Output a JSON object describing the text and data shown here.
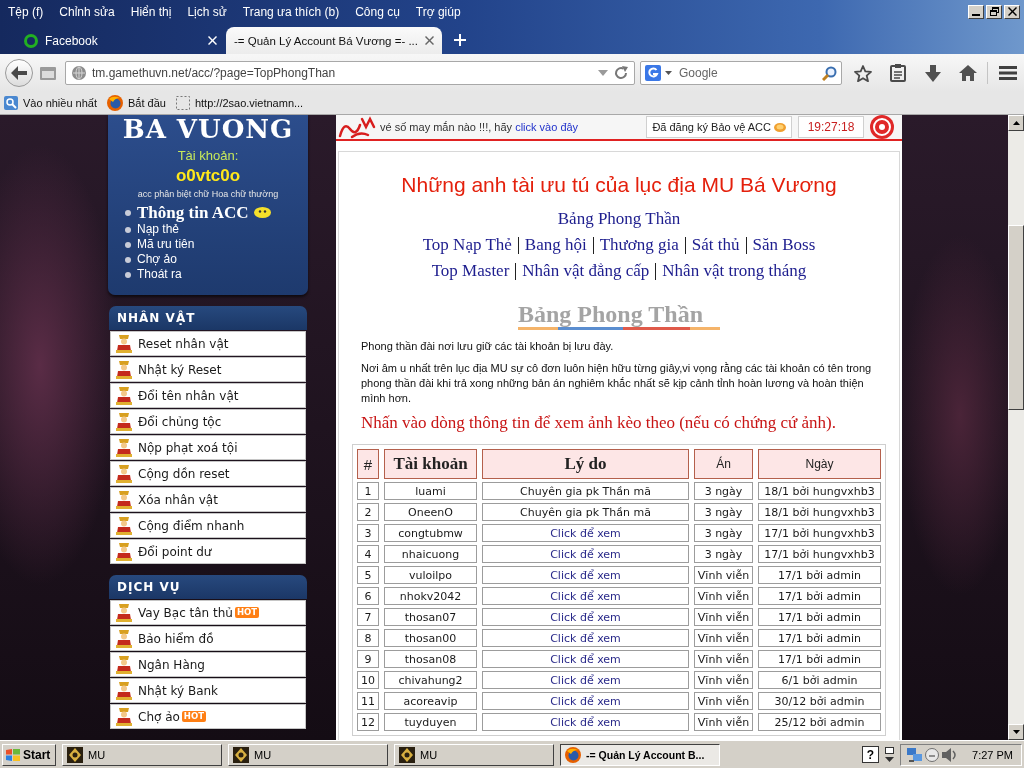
{
  "menu_bar": {
    "items": [
      "Tệp (f)",
      "Chỉnh sửa",
      "Hiển thị",
      "Lịch sử",
      "Trang ưa thích (b)",
      "Công cụ",
      "Trợ giúp"
    ]
  },
  "tabs": [
    {
      "label": "Facebook",
      "selected": false,
      "loading": true
    },
    {
      "label": "-= Quản Lý Account Bá Vương =- ...",
      "selected": true,
      "loading": false
    }
  ],
  "address_bar": {
    "value": "tm.gamethuvn.net/acc/?page=TopPhongThan"
  },
  "search": {
    "placeholder": "Google"
  },
  "bookmarks": [
    {
      "label": "Vào nhiều nhất",
      "kind": "folder"
    },
    {
      "label": "Bắt đầu",
      "kind": "browser"
    },
    {
      "label": "http://2sao.vietnamn...",
      "kind": "page"
    }
  ],
  "account_panel": {
    "logo": "BA VUONG",
    "label": "Tài khoản:",
    "username": "o0vtc0o",
    "note": "acc phân biệt chữ Hoa chữ thường",
    "links": [
      {
        "label": "Thông tin ACC",
        "kind": "heading"
      },
      {
        "label": "Nạp thẻ",
        "kind": "link"
      },
      {
        "label": "Mã ưu tiên",
        "kind": "link"
      },
      {
        "label": "Chợ ảo",
        "kind": "link"
      },
      {
        "label": "Thoát ra",
        "kind": "link"
      }
    ]
  },
  "sidebar": {
    "sections": [
      {
        "title": "NHÂN VẬT",
        "items": [
          {
            "label": "Reset nhân vật"
          },
          {
            "label": "Nhật ký Reset"
          },
          {
            "label": "Đổi tên nhân vật"
          },
          {
            "label": "Đổi chủng tộc"
          },
          {
            "label": "Nộp phạt xoá tội"
          },
          {
            "label": "Cộng dồn reset"
          },
          {
            "label": "Xóa nhân vật"
          },
          {
            "label": "Cộng điểm nhanh"
          },
          {
            "label": "Đổi point dư"
          }
        ]
      },
      {
        "title": "DỊCH VỤ",
        "items": [
          {
            "label": "Vay Bạc tân thủ",
            "badge": "HOT"
          },
          {
            "label": "Bảo hiểm đồ"
          },
          {
            "label": "Ngân Hàng"
          },
          {
            "label": "Nhật ký Bank"
          },
          {
            "label": "Chợ ảo",
            "badge": "HOT"
          }
        ]
      }
    ]
  },
  "banner": {
    "text": "vé số may mắn nào !!!, hãy",
    "link": "click vào đây",
    "protection": "Đã đăng ký Bảo vệ ACC",
    "clock": "19:27:18"
  },
  "content": {
    "title": "Những anh tài ưu tú của lục địa MU Bá Vương",
    "nav_rows": [
      [
        "Bảng Phong Thần"
      ],
      [
        "Top Nạp Thẻ",
        "Bang hội",
        "Thương gia",
        "Sát thủ",
        "Săn Boss"
      ],
      [
        "Top Master",
        "Nhân vật đẳng cấp",
        "Nhân vật trong tháng"
      ]
    ],
    "heading": "Bảng Phong Thần",
    "paragraphs": [
      "Phong thần đài nơi lưu giữ các tài khoản bị lưu đày.",
      "Nơi âm u nhất trên lục địa MU sự cô đơn luôn hiện hữu từng giây,vi vọng rằng các tài khoản có tên trong phong thần đài khi trả xong những bản án nghiêm khắc nhất sẽ kịp cảnh tỉnh hoàn lương và hoàn thiện mình hơn."
    ],
    "instruction": "Nhấn vào dòng thông tin để xem ảnh kèo theo (nếu có chứng cứ ảnh)."
  },
  "table": {
    "columns": [
      {
        "label": "#",
        "kind": "symbol"
      },
      {
        "label": "Tài khoản",
        "kind": "serif"
      },
      {
        "label": "Lý do",
        "kind": "serif"
      },
      {
        "label": "Án",
        "kind": "sans"
      },
      {
        "label": "Ngày",
        "kind": "sans"
      }
    ],
    "rows": [
      {
        "no": "1",
        "account": "luami",
        "reason": "Chuyên gia pk Thần mã",
        "kind": "text",
        "sentence": "3 ngày",
        "date": "18/1 bởi hungvxhb3"
      },
      {
        "no": "2",
        "account": "OneenO",
        "reason": "Chuyên gia pk Thần mã",
        "kind": "text",
        "sentence": "3 ngày",
        "date": "18/1 bởi hungvxhb3"
      },
      {
        "no": "3",
        "account": "congtubmw",
        "reason": "Click để xem",
        "kind": "link",
        "sentence": "3 ngày",
        "date": "17/1 bởi hungvxhb3"
      },
      {
        "no": "4",
        "account": "nhaicuong",
        "reason": "Click để xem",
        "kind": "link",
        "sentence": "3 ngày",
        "date": "17/1 bởi hungvxhb3"
      },
      {
        "no": "5",
        "account": "vuloilpo",
        "reason": "Click để xem",
        "kind": "link",
        "sentence": "Vĩnh viễn",
        "date": "17/1 bởi admin"
      },
      {
        "no": "6",
        "account": "nhokv2042",
        "reason": "Click để xem",
        "kind": "link",
        "sentence": "Vĩnh viễn",
        "date": "17/1 bởi admin"
      },
      {
        "no": "7",
        "account": "thosan07",
        "reason": "Click để xem",
        "kind": "link",
        "sentence": "Vĩnh viễn",
        "date": "17/1 bởi admin"
      },
      {
        "no": "8",
        "account": "thosan00",
        "reason": "Click để xem",
        "kind": "link",
        "sentence": "Vĩnh viễn",
        "date": "17/1 bởi admin"
      },
      {
        "no": "9",
        "account": "thosan08",
        "reason": "Click để xem",
        "kind": "link",
        "sentence": "Vĩnh viễn",
        "date": "17/1 bởi admin"
      },
      {
        "no": "10",
        "account": "chivahung2",
        "reason": "Click để xem",
        "kind": "link",
        "sentence": "Vĩnh viễn",
        "date": "6/1 bởi admin"
      },
      {
        "no": "11",
        "account": "acoreavip",
        "reason": "Click để xem",
        "kind": "link",
        "sentence": "Vĩnh viễn",
        "date": "30/12 bởi admin"
      },
      {
        "no": "12",
        "account": "tuyduyen",
        "reason": "Click để xem",
        "kind": "link",
        "sentence": "Vĩnh viễn",
        "date": "25/12 bởi admin"
      }
    ]
  },
  "taskbar": {
    "start": "Start",
    "buttons": [
      {
        "label": "MU",
        "kind": "game",
        "selected": false
      },
      {
        "label": "MU",
        "kind": "game",
        "selected": false
      },
      {
        "label": "MU",
        "kind": "game",
        "selected": false
      },
      {
        "label": "-= Quản Lý Account B...",
        "kind": "browser",
        "selected": true
      }
    ],
    "help": "?",
    "clock": "7:27 PM"
  }
}
